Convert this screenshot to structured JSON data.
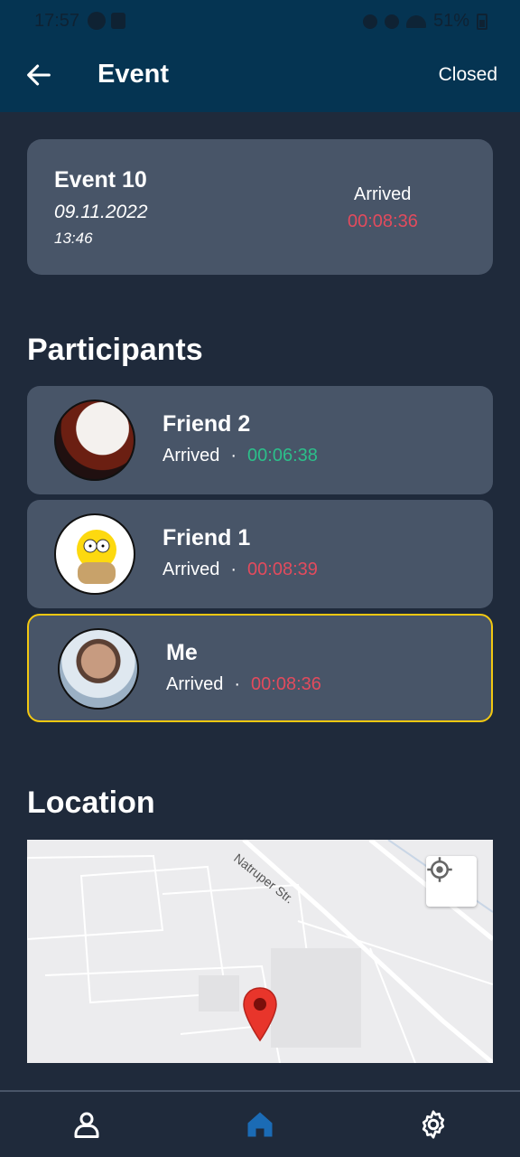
{
  "status_bar": {
    "time": "17:57",
    "battery": "51%"
  },
  "app_bar": {
    "title": "Event",
    "action": "Closed"
  },
  "event": {
    "name": "Event 10",
    "date": "09.11.2022",
    "time": "13:46",
    "status": "Arrived",
    "duration": "00:08:36"
  },
  "participants_title": "Participants",
  "participants": [
    {
      "name": "Friend 2",
      "status": "Arrived",
      "sep": "·",
      "time": "00:06:38",
      "time_color": "#2cbf8a"
    },
    {
      "name": "Friend 1",
      "status": "Arrived",
      "sep": "·",
      "time": "00:08:39",
      "time_color": "#e24b5d"
    },
    {
      "name": "Me",
      "status": "Arrived",
      "sep": "·",
      "time": "00:08:36",
      "time_color": "#e24b5d"
    }
  ],
  "location_title": "Location",
  "map": {
    "street": "Natruper Str."
  },
  "colors": {
    "accent": "#053452",
    "highlight": "#f2c811",
    "nav_active": "#1b6bb5"
  }
}
